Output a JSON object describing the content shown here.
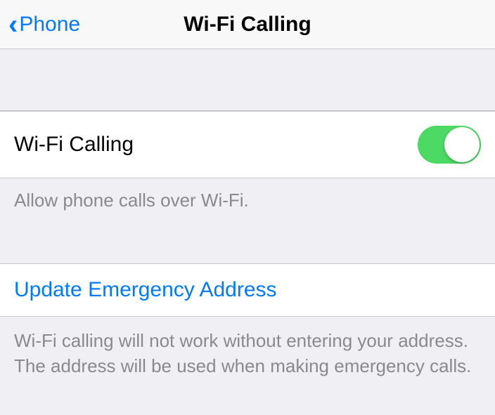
{
  "nav": {
    "back_label": "Phone",
    "title": "Wi-Fi Calling"
  },
  "main": {
    "wifi_calling_label": "Wi-Fi Calling",
    "wifi_calling_footer": "Allow phone calls over Wi-Fi.",
    "update_address_label": "Update Emergency Address",
    "emergency_info": "Wi-Fi calling will not work without entering your address. The address will be used when making emergency calls."
  },
  "colors": {
    "accent": "#007aff",
    "toggle_on": "#4cd964",
    "background": "#efeff4"
  }
}
